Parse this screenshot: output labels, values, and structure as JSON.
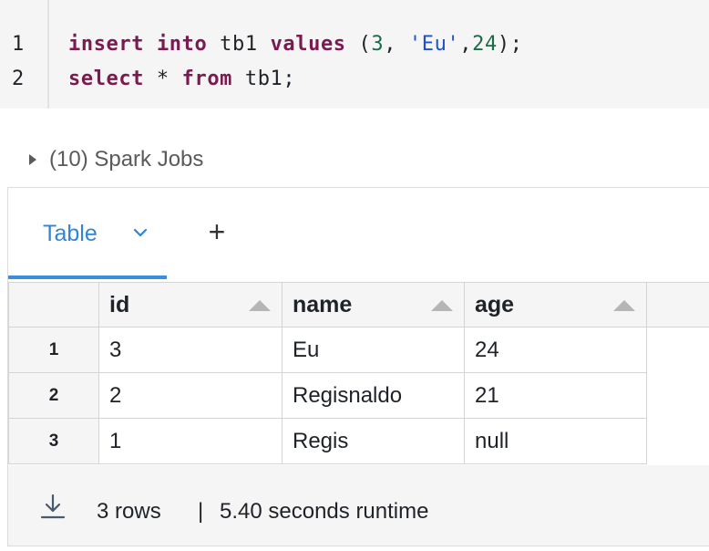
{
  "editor": {
    "line_numbers": [
      "1",
      "2"
    ],
    "lines": [
      [
        {
          "t": "insert",
          "c": "kw"
        },
        {
          "t": " ",
          "c": ""
        },
        {
          "t": "into",
          "c": "kw"
        },
        {
          "t": " tb1 ",
          "c": ""
        },
        {
          "t": "values",
          "c": "kw"
        },
        {
          "t": " (",
          "c": ""
        },
        {
          "t": "3",
          "c": "num"
        },
        {
          "t": ", ",
          "c": ""
        },
        {
          "t": "'Eu'",
          "c": "str"
        },
        {
          "t": ",",
          "c": ""
        },
        {
          "t": "24",
          "c": "num"
        },
        {
          "t": ");",
          "c": ""
        }
      ],
      [
        {
          "t": "select",
          "c": "kw"
        },
        {
          "t": " * ",
          "c": ""
        },
        {
          "t": "from",
          "c": "kw"
        },
        {
          "t": " tb1;",
          "c": ""
        }
      ]
    ]
  },
  "spark_jobs": {
    "label": "(10) Spark Jobs"
  },
  "tabs": {
    "table_label": "Table",
    "add_label": "+"
  },
  "table": {
    "columns": [
      "id",
      "name",
      "age"
    ],
    "rows": [
      {
        "index": "1",
        "id": "3",
        "name": "Eu",
        "age": "24"
      },
      {
        "index": "2",
        "id": "2",
        "name": "Regisnaldo",
        "age": "21"
      },
      {
        "index": "3",
        "id": "1",
        "name": "Regis",
        "age": "null"
      }
    ]
  },
  "footer": {
    "rows": "3 rows",
    "separator": "|",
    "runtime": "5.40 seconds runtime"
  },
  "colors": {
    "keyword": "#7a1a4f",
    "number": "#1c6b48",
    "string": "#1a4fd6",
    "accent": "#2f86d8"
  },
  "icons": {
    "expand": "caret-right-icon",
    "chevron": "chevron-down-icon",
    "download": "download-icon",
    "sort": "sort-asc-icon"
  }
}
